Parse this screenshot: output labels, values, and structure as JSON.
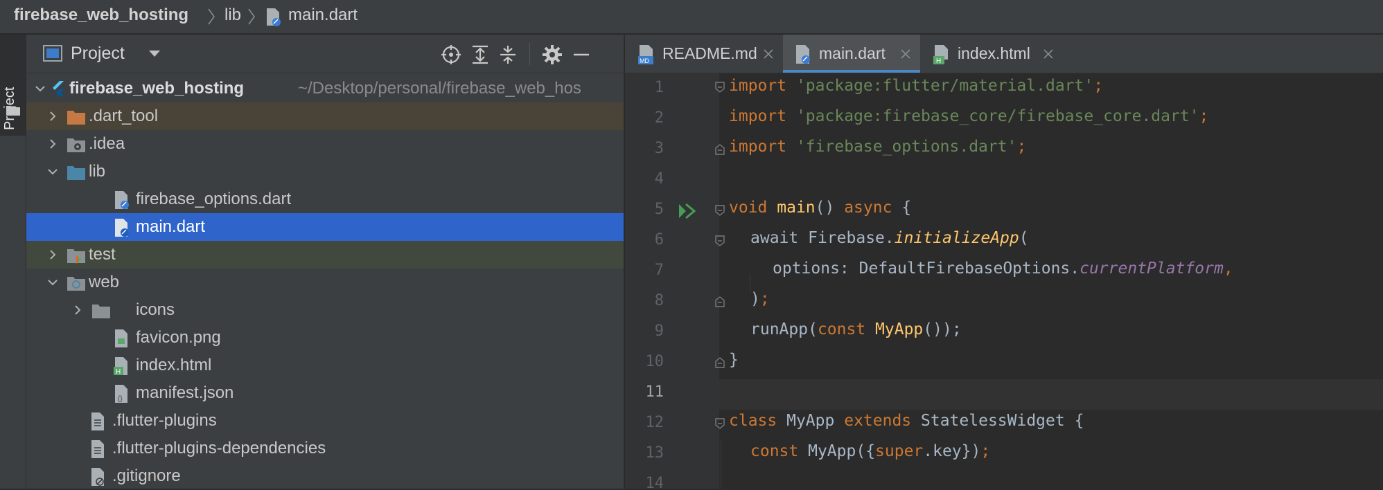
{
  "breadcrumb": {
    "project": "firebase_web_hosting",
    "folder": "lib",
    "file": "main.dart"
  },
  "toolstrip": {
    "project_label": "Project"
  },
  "project_panel": {
    "title": "Project",
    "root": {
      "name": "firebase_web_hosting",
      "path": "~/Desktop/personal/firebase_web_hos"
    },
    "items": [
      {
        "label": ".dart_tool"
      },
      {
        "label": ".idea"
      },
      {
        "label": "lib"
      },
      {
        "label": "firebase_options.dart"
      },
      {
        "label": "main.dart"
      },
      {
        "label": "test"
      },
      {
        "label": "web"
      },
      {
        "label": "icons"
      },
      {
        "label": "favicon.png"
      },
      {
        "label": "index.html"
      },
      {
        "label": "manifest.json"
      },
      {
        "label": ".flutter-plugins"
      },
      {
        "label": ".flutter-plugins-dependencies"
      },
      {
        "label": ".gitignore"
      }
    ]
  },
  "tabs": [
    {
      "label": "README.md",
      "icon_text": "MD"
    },
    {
      "label": "main.dart"
    },
    {
      "label": "index.html",
      "icon_text": "H"
    }
  ],
  "editor": {
    "line_numbers": [
      "1",
      "2",
      "3",
      "4",
      "5",
      "6",
      "7",
      "8",
      "9",
      "10",
      "11",
      "12",
      "13",
      "14"
    ],
    "tokens": {
      "import": "import",
      "s1": "'package:flutter/material.dart'",
      "s2": "'package:firebase_core/firebase_core.dart'",
      "s3": "'firebase_options.dart'",
      "semi": ";",
      "void": "void",
      "main": "main",
      "paren_open_close": "()",
      "async": "async",
      "brace_open": "{",
      "await": "await",
      "firebase_dot": "Firebase.",
      "initializeApp": "initializeApp",
      "paren_open": "(",
      "options": "options: DefaultFirebaseOptions.",
      "currentPlatform": "currentPlatform",
      "comma": ",",
      "paren_close": ")",
      "runApp": "runApp(",
      "const": "const",
      "myapp": "MyApp",
      "myapp_call_end": "());",
      "brace_close": "}",
      "class": "class",
      "extends": "extends",
      "stateless": "StatelessWidget",
      "ctor_open": "MyApp({",
      "super": "super",
      "key_end": ".key})",
      "space": " "
    }
  },
  "colors": {
    "keyword": "#cc7832",
    "string": "#6a8759",
    "function": "#ffc66d",
    "property": "#9876aa",
    "selection": "#2f65ca",
    "tab_underline": "#4a88c7"
  }
}
